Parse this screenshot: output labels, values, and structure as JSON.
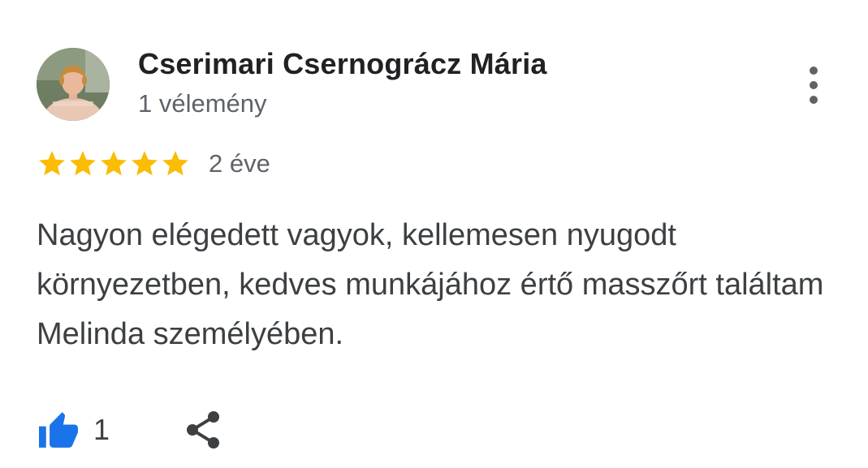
{
  "review": {
    "reviewer_name": "Cserimari Csernográcz Mária",
    "review_count": "1 vélemény",
    "rating": 5,
    "rating_max": 5,
    "date": "2 éve",
    "text": "Nagyon elégedett vagyok, kellemesen nyugodt környezetben, kedves munkájához értő masszőrt találtam Melinda személyében.",
    "likes": "1"
  },
  "icons": {
    "more": "more-vert-icon",
    "star": "star-icon",
    "like": "thumb-up-icon",
    "share": "share-icon"
  },
  "colors": {
    "star": "#FBBC04",
    "like": "#1A73E8",
    "secondary_text": "#5F6368",
    "primary_text": "#202124"
  }
}
